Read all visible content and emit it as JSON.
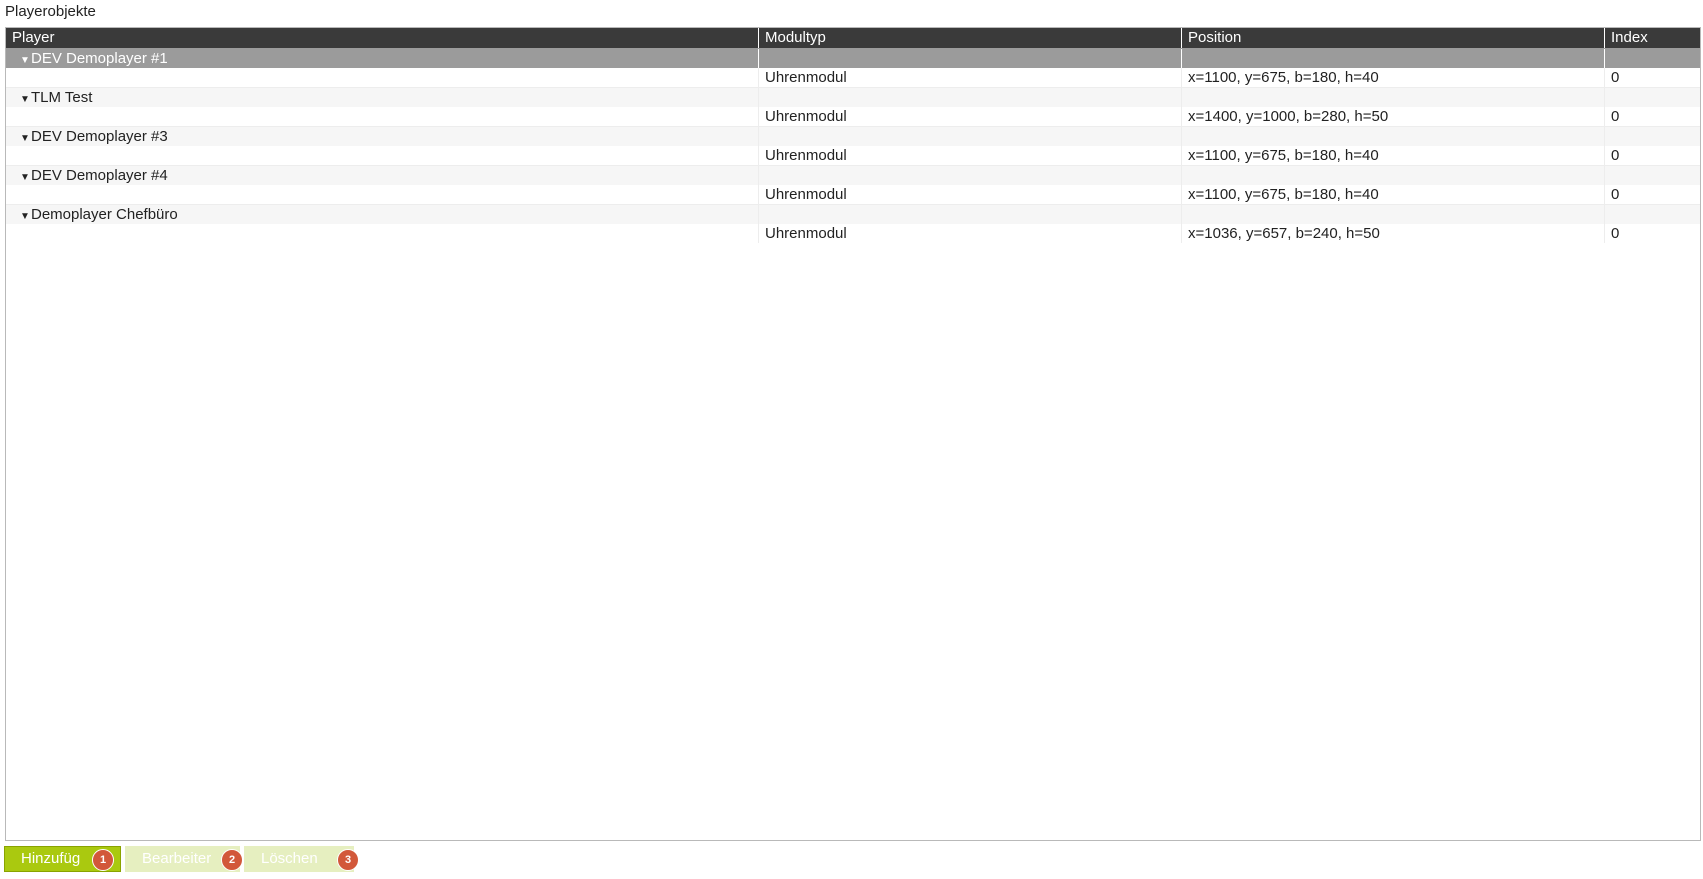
{
  "section_title": "Playerobjekte",
  "columns": {
    "player": "Player",
    "modultyp": "Modultyp",
    "position": "Position",
    "index": "Index"
  },
  "groups": [
    {
      "name": "DEV Demoplayer #1",
      "selected": true,
      "item": {
        "modultyp": "Uhrenmodul",
        "position": "x=1100, y=675, b=180, h=40",
        "index": "0"
      }
    },
    {
      "name": "TLM Test",
      "selected": false,
      "item": {
        "modultyp": "Uhrenmodul",
        "position": "x=1400, y=1000, b=280, h=50",
        "index": "0"
      }
    },
    {
      "name": "DEV Demoplayer #3",
      "selected": false,
      "item": {
        "modultyp": "Uhrenmodul",
        "position": "x=1100, y=675, b=180, h=40",
        "index": "0"
      }
    },
    {
      "name": "DEV Demoplayer #4",
      "selected": false,
      "item": {
        "modultyp": "Uhrenmodul",
        "position": "x=1100, y=675, b=180, h=40",
        "index": "0"
      }
    },
    {
      "name": "Demoplayer Chefbüro",
      "selected": false,
      "item": {
        "modultyp": "Uhrenmodul",
        "position": "x=1036, y=657, b=240, h=50",
        "index": "0"
      }
    }
  ],
  "tree_toggle_glyph": "▼",
  "buttons": {
    "add": {
      "label": "Hinzufüg",
      "badge": "1"
    },
    "edit": {
      "label": "Bearbeiter",
      "badge": "2"
    },
    "delete": {
      "label": "Löschen",
      "badge": "3"
    }
  },
  "colors": {
    "header_bg": "#3a3a3a",
    "selected_row_bg": "#9b9b9b",
    "primary_button": "#aac90f",
    "disabled_button": "#e6efc0",
    "badge": "#d2583a"
  }
}
